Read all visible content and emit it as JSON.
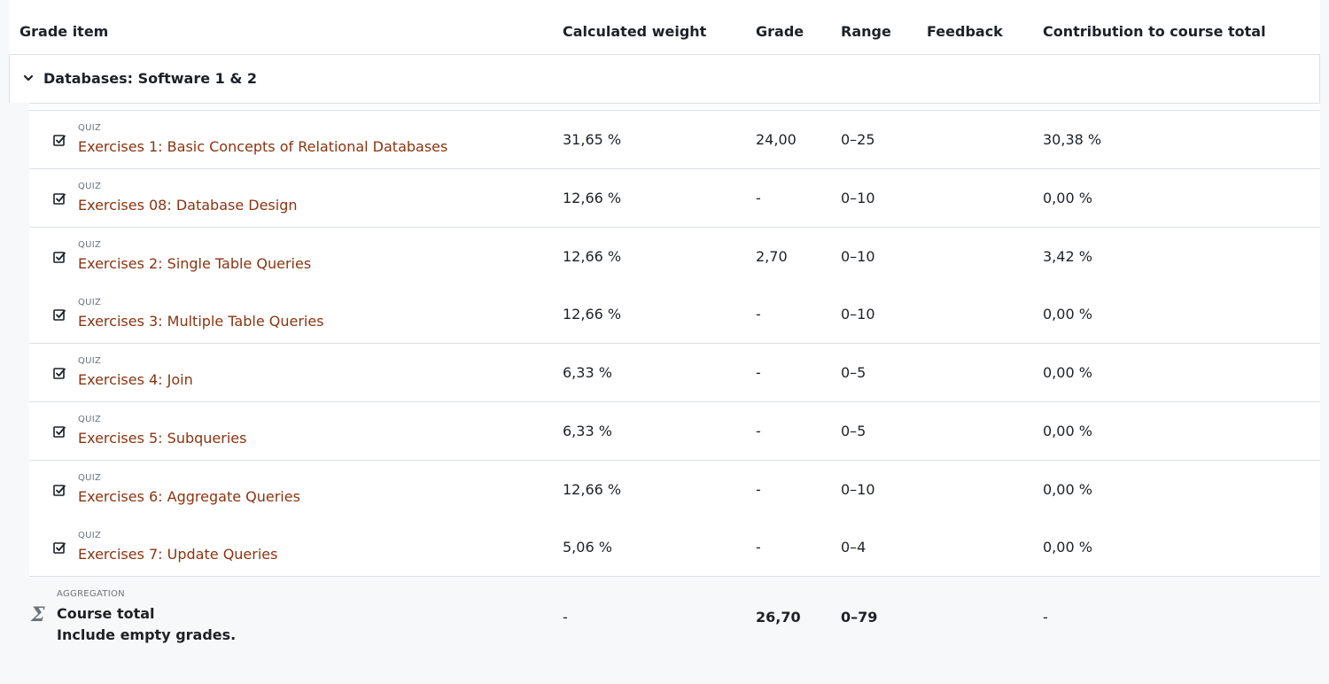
{
  "table": {
    "headers": {
      "grade_item": "Grade item",
      "calculated_weight": "Calculated weight",
      "grade": "Grade",
      "range": "Range",
      "feedback": "Feedback",
      "contribution": "Contribution to course total"
    },
    "category": {
      "name": "Databases: Software 1 & 2",
      "icon": "chevron-down-icon"
    },
    "items": [
      {
        "type": "QUIZ",
        "name": "Exercises 1: Basic Concepts of Relational Databases",
        "weight": "31,65 %",
        "grade": "24,00",
        "range": "0–25",
        "feedback": "",
        "contribution": "30,38 %"
      },
      {
        "type": "QUIZ",
        "name": "Exercises 08: Database Design",
        "weight": "12,66 %",
        "grade": "-",
        "range": "0–10",
        "feedback": "",
        "contribution": "0,00 %"
      },
      {
        "type": "QUIZ",
        "name": "Exercises 2: Single Table Queries",
        "weight": "12,66 %",
        "grade": "2,70",
        "range": "0–10",
        "feedback": "",
        "contribution": "3,42 %"
      },
      {
        "type": "QUIZ",
        "name": "Exercises 3: Multiple Table Queries",
        "weight": "12,66 %",
        "grade": "-",
        "range": "0–10",
        "feedback": "",
        "contribution": "0,00 %"
      },
      {
        "type": "QUIZ",
        "name": "Exercises 4: Join",
        "weight": "6,33 %",
        "grade": "-",
        "range": "0–5",
        "feedback": "",
        "contribution": "0,00 %"
      },
      {
        "type": "QUIZ",
        "name": "Exercises 5: Subqueries",
        "weight": "6,33 %",
        "grade": "-",
        "range": "0–5",
        "feedback": "",
        "contribution": "0,00 %"
      },
      {
        "type": "QUIZ",
        "name": "Exercises 6: Aggregate Queries",
        "weight": "12,66 %",
        "grade": "-",
        "range": "0–10",
        "feedback": "",
        "contribution": "0,00 %"
      },
      {
        "type": "QUIZ",
        "name": "Exercises 7: Update Queries",
        "weight": "5,06 %",
        "grade": "-",
        "range": "0–4",
        "feedback": "",
        "contribution": "0,00 %"
      }
    ],
    "total": {
      "type": "AGGREGATION",
      "name": "Course total",
      "note": "Include empty grades.",
      "weight": "-",
      "grade": "26,70",
      "range": "0–79",
      "contribution": "-",
      "icon": "sigma-icon"
    }
  },
  "colors": {
    "link": "#8a3410",
    "border": "#dee2e6",
    "muted": "#6a737b",
    "panel_bg": "#f7f8f9"
  }
}
